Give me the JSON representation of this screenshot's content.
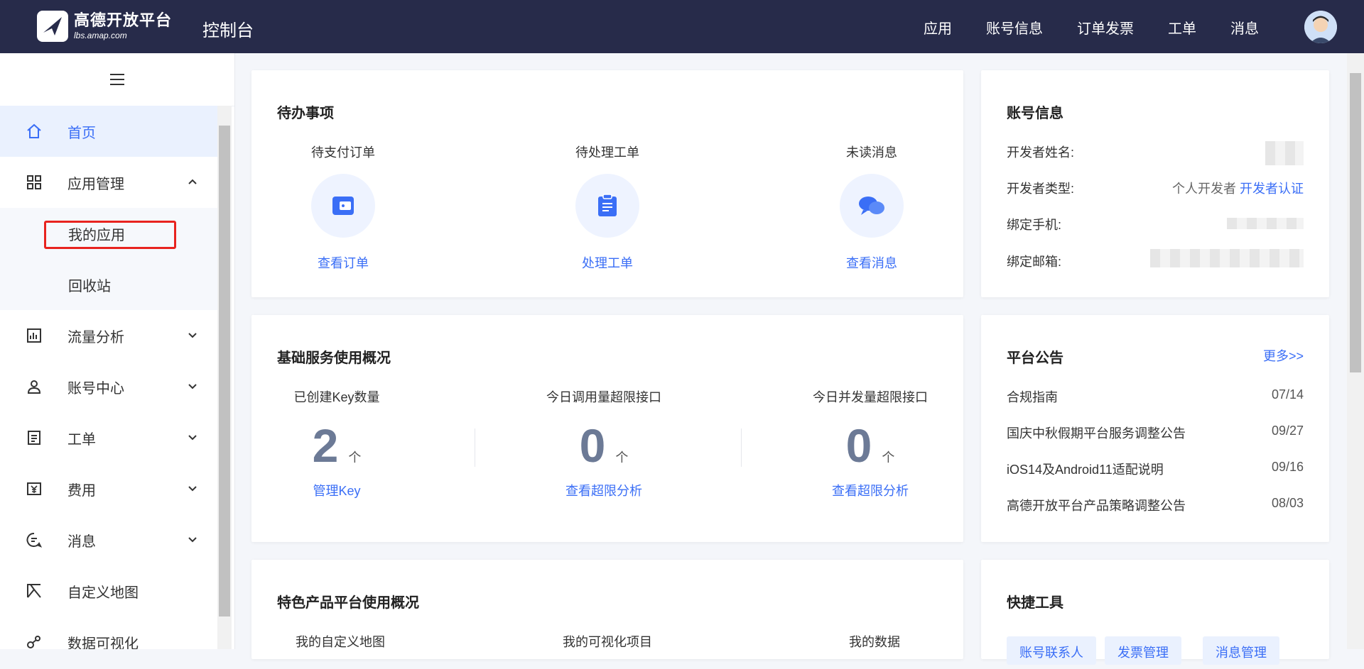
{
  "header": {
    "logo_name": "高德开放平台",
    "logo_domain": "lbs.amap.com",
    "console_title": "控制台",
    "nav": [
      "应用",
      "账号信息",
      "订单发票",
      "工单",
      "消息"
    ]
  },
  "sidebar": {
    "items": [
      {
        "label": "首页",
        "icon": "home-icon"
      },
      {
        "label": "应用管理",
        "icon": "grid-icon"
      },
      {
        "label": "我的应用"
      },
      {
        "label": "回收站"
      },
      {
        "label": "流量分析",
        "icon": "chart-icon"
      },
      {
        "label": "账号中心",
        "icon": "user-icon"
      },
      {
        "label": "工单",
        "icon": "ticket-icon"
      },
      {
        "label": "费用",
        "icon": "yen-icon"
      },
      {
        "label": "消息",
        "icon": "message-icon"
      },
      {
        "label": "自定义地图",
        "icon": "map-icon"
      },
      {
        "label": "数据可视化",
        "icon": "visual-icon"
      }
    ]
  },
  "todo": {
    "title": "待办事项",
    "cols": [
      {
        "title": "待支付订单",
        "link": "查看订单",
        "icon": "wallet-icon"
      },
      {
        "title": "待处理工单",
        "link": "处理工单",
        "icon": "clipboard-icon"
      },
      {
        "title": "未读消息",
        "link": "查看消息",
        "icon": "chat-icon"
      }
    ]
  },
  "basic": {
    "title": "基础服务使用概况",
    "cols": [
      {
        "title": "已创建Key数量",
        "value": "2",
        "unit": "个",
        "link": "管理Key"
      },
      {
        "title": "今日调用量超限接口",
        "value": "0",
        "unit": "个",
        "link": "查看超限分析"
      },
      {
        "title": "今日并发量超限接口",
        "value": "0",
        "unit": "个",
        "link": "查看超限分析"
      }
    ]
  },
  "featured": {
    "title": "特色产品平台使用概况",
    "cols": [
      "我的自定义地图",
      "我的可视化项目",
      "我的数据"
    ]
  },
  "account": {
    "title": "账号信息",
    "rows": [
      {
        "label": "开发者姓名:"
      },
      {
        "label": "开发者类型:",
        "value": "个人开发者",
        "link": "开发者认证"
      },
      {
        "label": "绑定手机:"
      },
      {
        "label": "绑定邮箱:"
      }
    ]
  },
  "notice": {
    "title": "平台公告",
    "more": "更多>>",
    "rows": [
      {
        "text": "合规指南",
        "date": "07/14"
      },
      {
        "text": "国庆中秋假期平台服务调整公告",
        "date": "09/27"
      },
      {
        "text": "iOS14及Android11适配说明",
        "date": "09/16"
      },
      {
        "text": "高德开放平台产品策略调整公告",
        "date": "08/03"
      }
    ]
  },
  "tools": {
    "title": "快捷工具",
    "buttons": [
      "账号联系人",
      "发票管理",
      "消息管理"
    ]
  },
  "colors": {
    "accent": "#3a6ef6",
    "header_bg": "#272b4a",
    "highlight": "#e8231f"
  }
}
